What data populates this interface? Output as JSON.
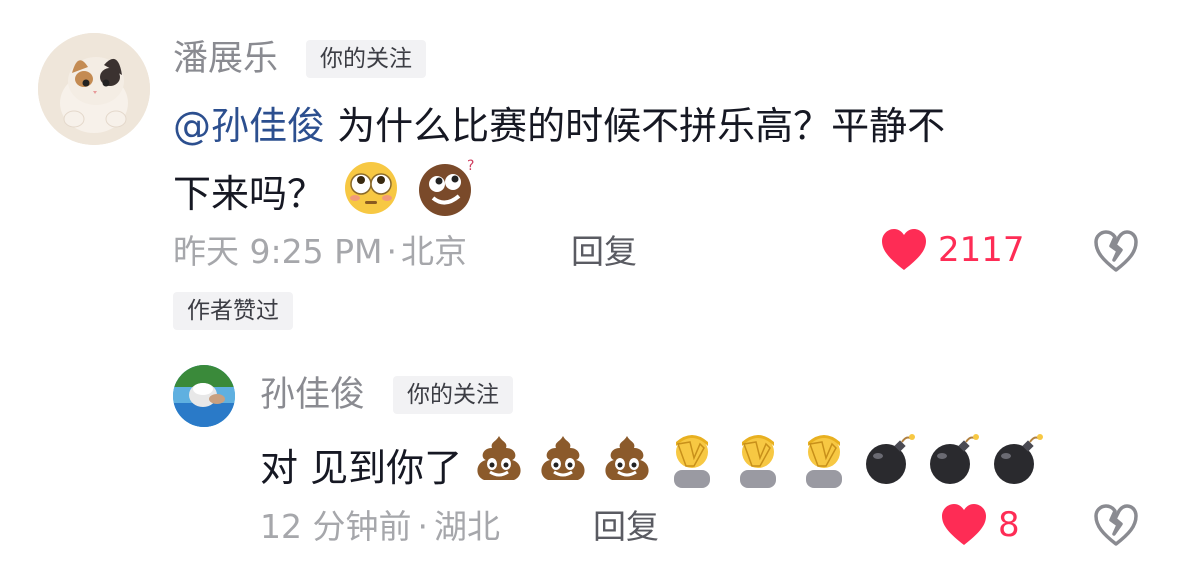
{
  "comment": {
    "username": "潘展乐",
    "follow_tag": "你的关注",
    "mention": "@孙佳俊",
    "text_line1": " 为什么比赛的时候不拼乐高？平静不",
    "text_line2": "下来吗？",
    "emojis": [
      "flushed-face-emoji",
      "rolling-eyes-brown-emoji"
    ],
    "time": "昨天 9:25 PM",
    "location_sep": "·",
    "location": "北京",
    "reply_label": "回复",
    "likes": "2117",
    "author_liked": "作者赞过"
  },
  "reply": {
    "username": "孙佳俊",
    "follow_tag": "你的关注",
    "text": "对 见到你了",
    "emojis": [
      "poo-emoji",
      "poo-emoji",
      "poo-emoji",
      "facepalm-emoji",
      "facepalm-emoji",
      "facepalm-emoji",
      "bomb-emoji",
      "bomb-emoji",
      "bomb-emoji"
    ],
    "time": "12 分钟前",
    "location_sep": "·",
    "location": "湖北",
    "reply_label": "回复",
    "likes": "8"
  },
  "colors": {
    "like_red": "#fe2c55",
    "mention_blue": "#2c4f8f",
    "meta_gray": "#a6a7ab"
  }
}
